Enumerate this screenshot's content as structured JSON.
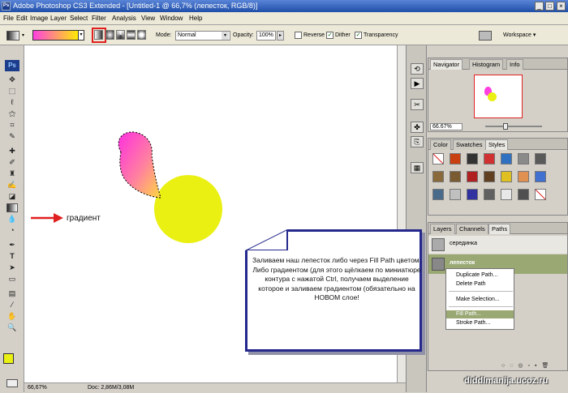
{
  "window": {
    "title": "Adobe Photoshop CS3 Extended - [Untitled-1 @ 66,7% (лепесток, RGB/8)]",
    "app_icon": "Ps"
  },
  "menu": [
    "File",
    "Edit",
    "Image",
    "Layer",
    "Select",
    "Filter",
    "Analysis",
    "View",
    "Window",
    "Help"
  ],
  "options": {
    "mode_label": "Mode:",
    "mode_value": "Normal",
    "opacity_label": "Opacity:",
    "opacity_value": "100%",
    "reverse_label": "Reverse",
    "dither_label": "Dither",
    "transparency_label": "Transparency",
    "workspace_label": "Workspace ▾",
    "checks": {
      "reverse": false,
      "dither": true,
      "transparency": true
    }
  },
  "canvas": {
    "annotation": "градиент"
  },
  "status": {
    "zoom": "66,67%",
    "doc": "Doc: 2,86M/3,08M"
  },
  "navigator": {
    "tabs": [
      "Navigator",
      "Histogram",
      "Info"
    ],
    "zoom": "66.67%"
  },
  "swatches_panel": {
    "tabs": [
      "Color",
      "Swatches",
      "Styles"
    ]
  },
  "layers_panel": {
    "tabs": [
      "Layers",
      "Channels",
      "Paths"
    ],
    "paths": [
      "серединка",
      "лепесток"
    ]
  },
  "context_menu": {
    "items": [
      "Duplicate Path...",
      "Delete Path",
      "Make Selection...",
      "Fill Path...",
      "Stroke Path..."
    ],
    "highlighted": "Fill Path..."
  },
  "note": {
    "text": "Заливаем наш лепесток либо через Fill Path цветом. Либо градиентом (для этого щёлкаем по миниатюре контура с нажатой Ctrl, получаем выделение которое и заливаем градиентом (обязательно на НОВОМ слое!"
  },
  "watermark": "diddlmanija.ucoz.ru",
  "colors": {
    "accent_red": "#e02020",
    "yellow": "#eaf012",
    "pink": "#ff40d8",
    "note_border": "#24288c",
    "menu_highlight": "#9aa874"
  }
}
